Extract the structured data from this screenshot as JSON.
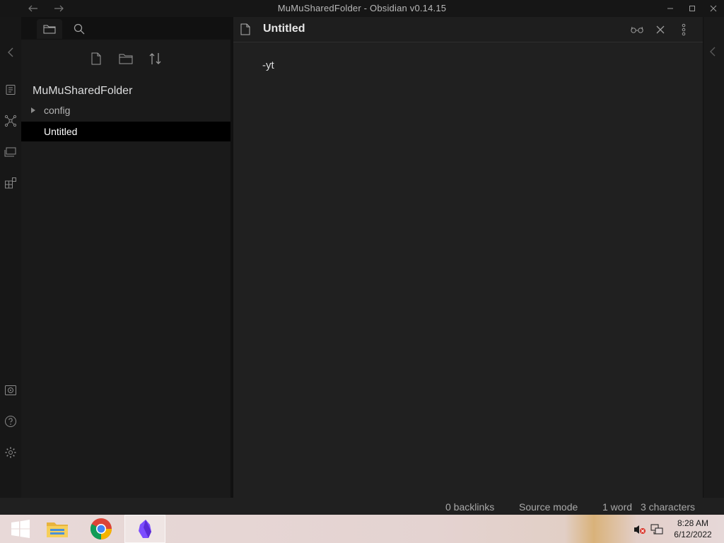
{
  "window": {
    "title": "MuMuSharedFolder - Obsidian v0.14.15"
  },
  "titlebar": {
    "back_icon": "arrow-left-icon",
    "forward_icon": "arrow-right-icon",
    "minimize_icon": "minimize-icon",
    "maximize_icon": "maximize-icon",
    "close_icon": "close-icon"
  },
  "ribbon": {
    "items": [
      {
        "icon": "collapse-left-icon"
      },
      {
        "icon": "quick-switcher-icon"
      },
      {
        "icon": "graph-view-icon"
      },
      {
        "icon": "slides-icon"
      },
      {
        "icon": "kanban-icon"
      },
      {
        "icon": "vault-icon"
      },
      {
        "icon": "help-icon"
      },
      {
        "icon": "settings-icon"
      }
    ]
  },
  "sidebar": {
    "tabs": [
      {
        "icon": "folder-icon",
        "active": true
      },
      {
        "icon": "search-icon",
        "active": false
      }
    ],
    "actions": [
      {
        "icon": "new-note-icon"
      },
      {
        "icon": "new-folder-icon"
      },
      {
        "icon": "sort-icon"
      }
    ],
    "vault_name": "MuMuSharedFolder",
    "tree": {
      "folder": {
        "label": "config",
        "collapsed": true
      },
      "file": {
        "label": "Untitled",
        "selected": true
      }
    }
  },
  "editor": {
    "tab_title": "Untitled",
    "content": "-yt",
    "header_actions": [
      {
        "icon": "reading-view-icon"
      },
      {
        "icon": "close-icon"
      },
      {
        "icon": "more-options-icon"
      }
    ]
  },
  "statusbar": {
    "backlinks": "0 backlinks",
    "mode": "Source mode",
    "words": "1 word",
    "characters": "3 characters"
  },
  "taskbar": {
    "apps": [
      {
        "icon": "windows-start-icon"
      },
      {
        "icon": "file-explorer-icon"
      },
      {
        "icon": "chrome-icon"
      },
      {
        "icon": "obsidian-icon",
        "active": true
      }
    ],
    "tray": [
      {
        "icon": "volume-muted-icon"
      },
      {
        "icon": "network-icon"
      }
    ],
    "time": "8:28 AM",
    "date": "6/12/2022"
  },
  "colors": {
    "background": "#1e1e1e",
    "sidebar": "#1a1a1a",
    "selected_file": "#000000",
    "text": "#dcddde",
    "obsidian_accent": "#7c4dff"
  }
}
